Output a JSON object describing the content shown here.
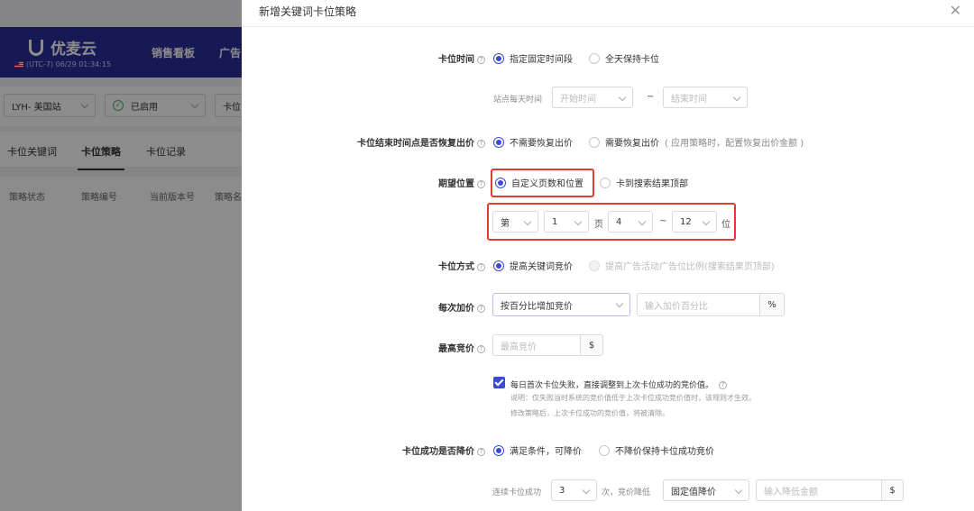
{
  "background": {
    "logo_text": "优麦云",
    "clock_text": "(UTC-7) 06/29 01:34:15",
    "nav": [
      "销售看板",
      "广告"
    ],
    "filters": {
      "site": "LYH- 美国站",
      "status": "已启用",
      "third": "卡位"
    },
    "tabs": [
      "卡位关键词",
      "卡位策略",
      "卡位记录"
    ],
    "columns": [
      "策略状态",
      "策略编号",
      "当前版本号",
      "策略名"
    ]
  },
  "drawer": {
    "title": "新增关键词卡位策略",
    "sections": {
      "slot_time": {
        "label": "卡位时间",
        "opt_custom": "指定固定时间段",
        "opt_allday": "全天保持卡位",
        "site_daily_label": "站点每天时间",
        "start_placeholder": "开始时间",
        "end_placeholder": "结束时间",
        "tilde": "~"
      },
      "restore": {
        "label": "卡位结束时间点是否恢复出价",
        "opt_no": "不需要恢复出价",
        "opt_yes": "需要恢复出价",
        "opt_yes_hint": "( 应用策略时，配置恢复出价金额 )"
      },
      "expected": {
        "label": "期望位置",
        "opt_custom": "自定义页数和位置",
        "opt_top": "卡到搜索结果顶部",
        "page_prefix": "第",
        "page_value": "1",
        "page_unit": "页",
        "pos_from": "4",
        "tilde": "~",
        "pos_to": "12",
        "pos_unit": "位"
      },
      "method": {
        "label": "卡位方式",
        "opt_keyword": "提高关键词竞价",
        "opt_ratio": "提高广告活动广告位比例(搜索结果页顶部)"
      },
      "increment": {
        "label": "每次加价",
        "mode_value": "按百分比增加竞价",
        "input_placeholder": "输入加价百分比",
        "suffix": "%"
      },
      "max_bid": {
        "label": "最高竞价",
        "placeholder": "最高竞价",
        "suffix": "$"
      },
      "fallback": {
        "main": "每日首次卡位失败，直接调整到上次卡位成功的竞价值。",
        "note1": "说明：仅失败当时系统的竞价值低于上次卡位成功竞价值时，该规则才生效。",
        "note2": "修改策略后，上次卡位成功的竞价值，将被清除。"
      },
      "lower": {
        "label": "卡位成功是否降价",
        "opt_yes": "满足条件，可降价",
        "opt_no": "不降价保持卡位成功竞价",
        "consecutive_label": "连续卡位成功",
        "count_value": "3",
        "times_text": "次，竞价降低",
        "mode_value": "固定值降价",
        "amount_placeholder": "输入降低金额",
        "suffix": "$"
      }
    }
  },
  "colors": {
    "primary": "#3c48d8",
    "highlight": "#e53935",
    "topbar": "#2b2f9c"
  }
}
